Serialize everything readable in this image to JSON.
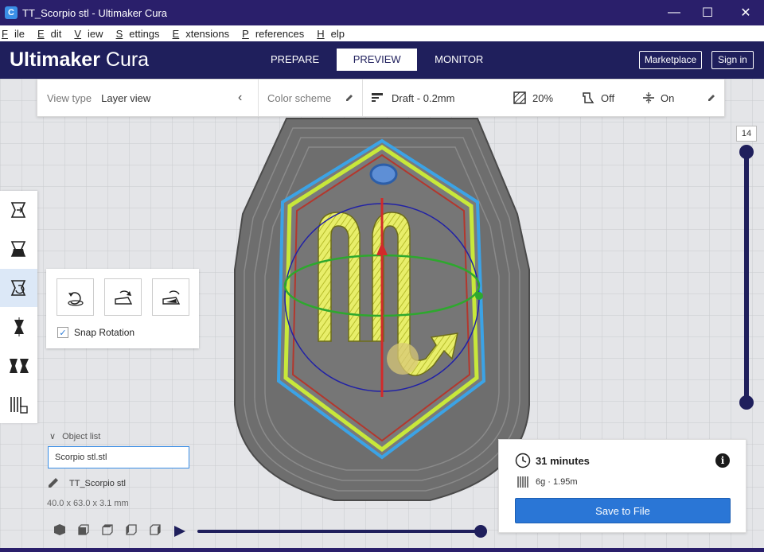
{
  "window": {
    "title": "TT_Scorpio stl - Ultimaker Cura",
    "app_icon_letter": "C",
    "minimize": "—",
    "maximize": "☐",
    "close": "✕"
  },
  "menu": {
    "items": [
      {
        "u": "F",
        "rest": "ile"
      },
      {
        "u": "E",
        "rest": "dit"
      },
      {
        "u": "V",
        "rest": "iew"
      },
      {
        "u": "S",
        "rest": "ettings"
      },
      {
        "u": "E",
        "rest": "xtensions"
      },
      {
        "u": "P",
        "rest": "references"
      },
      {
        "u": "H",
        "rest": "elp"
      }
    ]
  },
  "header": {
    "logo_bold": "Ultimaker",
    "logo_light": " Cura",
    "stages": {
      "prepare": "PREPARE",
      "preview": "PREVIEW",
      "monitor": "MONITOR"
    },
    "marketplace": "Marketplace",
    "sign_in": "Sign in"
  },
  "view_toolbar": {
    "view_type_label": "View type",
    "view_type_value": "Layer view",
    "color_scheme_label": "Color scheme",
    "profile": "Draft - 0.2mm",
    "infill": "20%",
    "support": "Off",
    "adhesion": "On"
  },
  "rotate_panel": {
    "snap_label": "Snap Rotation",
    "snap_checked": true
  },
  "object_list": {
    "label": "Object list",
    "input_value": "Scorpio stl.stl",
    "object_name": "TT_Scorpio stl",
    "dimensions": "40.0 x 63.0 x 3.1 mm"
  },
  "layer_slider": {
    "current_layer": "14",
    "level": 1.0
  },
  "simulation": {
    "progress": 1.0
  },
  "print_info": {
    "time": "31 minutes",
    "material": "6g · 1.95m",
    "save_label": "Save to File"
  },
  "colors": {
    "header": "#1f1f5c",
    "titlebar": "#2a1f6b",
    "accent": "#2a76d6"
  }
}
